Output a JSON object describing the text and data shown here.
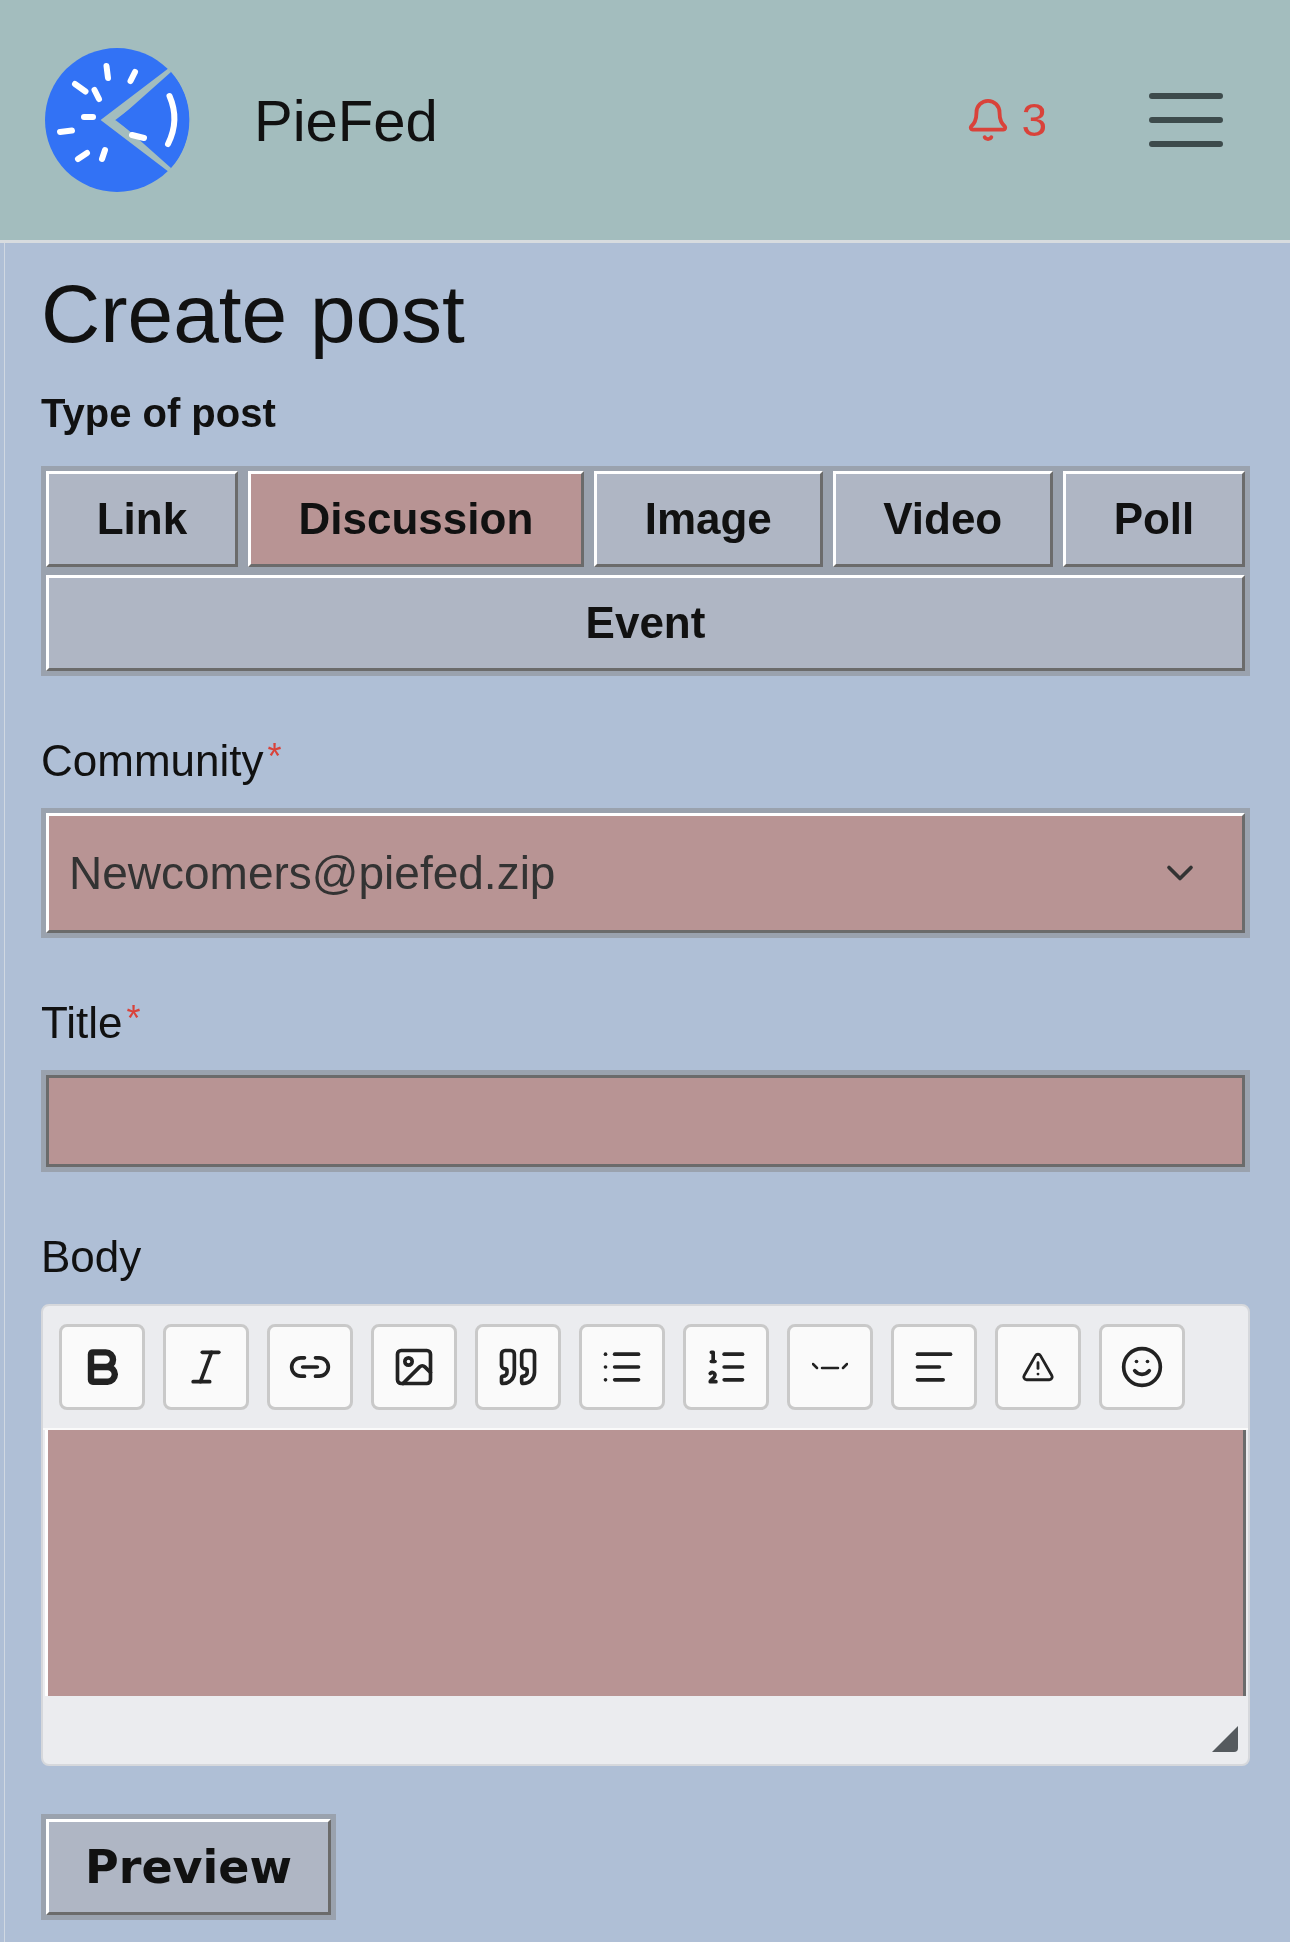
{
  "header": {
    "site_name": "PieFed",
    "notifications": "3"
  },
  "page": {
    "title": "Create post"
  },
  "post_type": {
    "label": "Type of post",
    "tabs": [
      {
        "label": "Link",
        "selected": false
      },
      {
        "label": "Discussion",
        "selected": true
      },
      {
        "label": "Image",
        "selected": false
      },
      {
        "label": "Video",
        "selected": false
      },
      {
        "label": "Poll",
        "selected": false
      },
      {
        "label": "Event",
        "selected": false
      }
    ]
  },
  "community": {
    "label": "Community",
    "required_mark": "*",
    "value": "Newcomers@piefed.zip"
  },
  "title_field": {
    "label": "Title",
    "required_mark": "*"
  },
  "body": {
    "label": "Body"
  },
  "buttons": [
    "Preview"
  ]
}
